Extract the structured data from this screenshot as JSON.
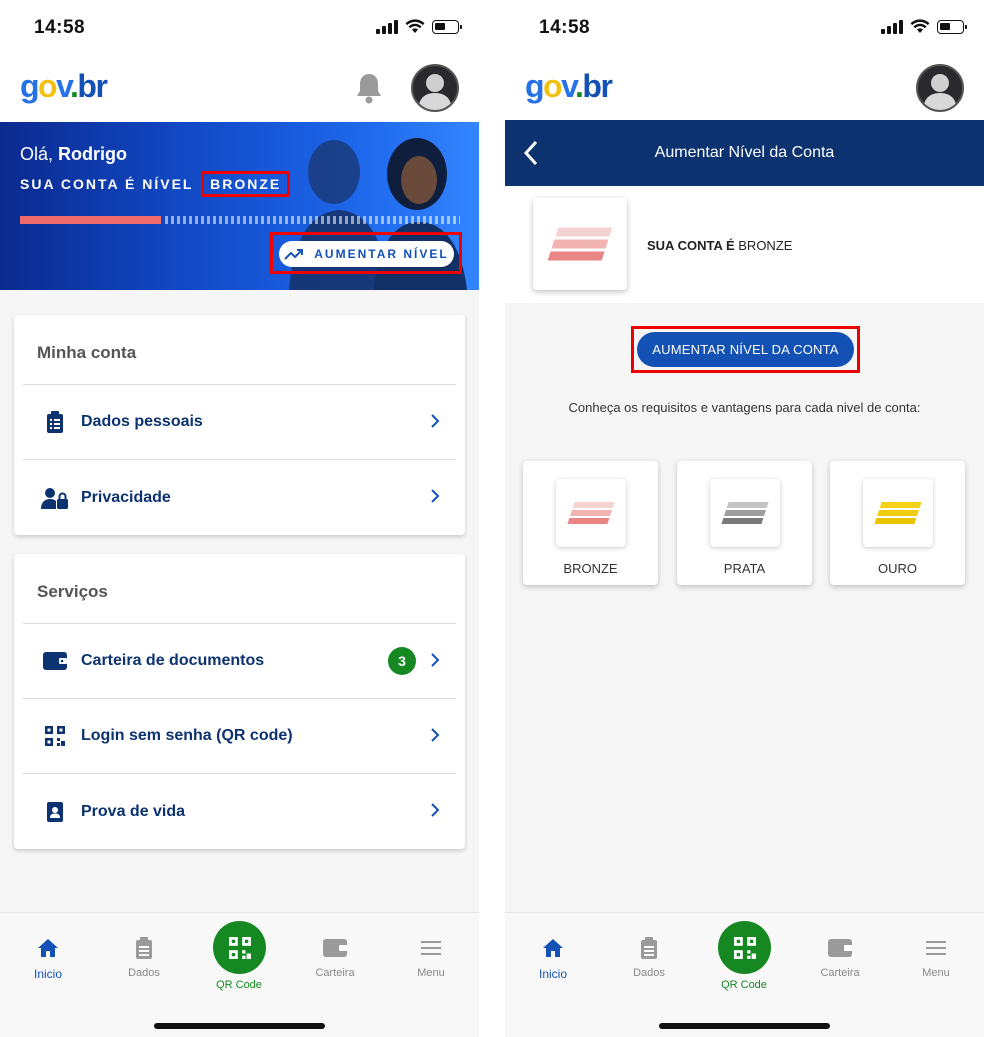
{
  "status": {
    "time": "14:58"
  },
  "logo": {
    "g": "g",
    "o": "o",
    "v": "v",
    "dot": ".",
    "br": "br"
  },
  "left": {
    "greeting_prefix": "Olá,",
    "user_name": "Rodrigo",
    "level_prefix": "SUA CONTA É NÍVEL",
    "level": "BRONZE",
    "level_progress": 0.32,
    "raise_button": "AUMENTAR NÍVEL",
    "account_card": {
      "title": "Minha conta",
      "items": [
        {
          "label": "Dados pessoais",
          "icon": "clipboard-icon"
        },
        {
          "label": "Privacidade",
          "icon": "user-lock-icon"
        }
      ]
    },
    "services_card": {
      "title": "Serviços",
      "items": [
        {
          "label": "Carteira de documentos",
          "icon": "wallet-icon",
          "badge": "3"
        },
        {
          "label": "Login sem senha (QR code)",
          "icon": "qr-icon"
        },
        {
          "label": "Prova de vida",
          "icon": "id-badge-icon"
        }
      ]
    }
  },
  "right": {
    "nav_title": "Aumentar Nível da Conta",
    "account_prefix": "SUA CONTA É",
    "account_level": "BRONZE",
    "raise_button": "AUMENTAR NÍVEL DA CONTA",
    "requirements_text": "Conheça os requisitos e vantagens para cada nivel de conta:",
    "tiers": [
      {
        "name": "BRONZE",
        "color_light": "#f6d3d3",
        "color_dark": "#e88686"
      },
      {
        "name": "PRATA",
        "color_light": "#c4c4c4",
        "color_dark": "#7a7a7a"
      },
      {
        "name": "OURO",
        "color_light": "#f4d218",
        "color_dark": "#e8c400"
      }
    ]
  },
  "tabbar": {
    "items": [
      {
        "label": "Inicio",
        "icon": "home-icon",
        "active": true
      },
      {
        "label": "Dados",
        "icon": "clipboard-icon"
      },
      {
        "label": "QR Code",
        "icon": "qr-icon"
      },
      {
        "label": "Carteira",
        "icon": "wallet-icon"
      },
      {
        "label": "Menu",
        "icon": "menu-icon"
      }
    ]
  },
  "colors": {
    "primary": "#1351b4",
    "navy": "#0c326f",
    "green": "#168821",
    "highlight": "#e00000"
  }
}
